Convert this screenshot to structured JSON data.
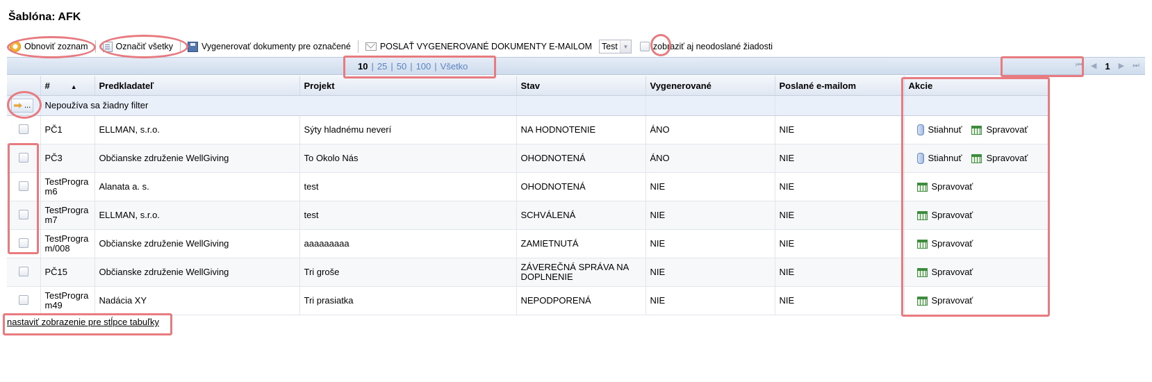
{
  "page_title": "Šablóna: AFK",
  "toolbar": {
    "refresh_label": "Obnoviť zoznam",
    "select_all_label": "Označiť všetky",
    "generate_label": "Vygenerovať dokumenty pre označené",
    "send_label": "POSLAŤ VYGENEROVANÉ DOKUMENTY E-MAILOM",
    "select_value": "Test",
    "show_unsent_label": "zobraziť aj neodoslané žiadosti"
  },
  "pager": {
    "page_sizes": [
      "10",
      "25",
      "50",
      "100",
      "Všetko"
    ],
    "current_size": "10",
    "current_page": "1",
    "first": "⏮",
    "prev": "◀",
    "next": "▶",
    "last": "⏭"
  },
  "table": {
    "headers": {
      "num": "#",
      "applicant": "Predkladateľ",
      "project": "Projekt",
      "status": "Stav",
      "generated": "Vygenerované",
      "emailed": "Poslané e-mailom",
      "actions": "Akcie"
    },
    "sort_indicator": "▲",
    "filter_button_label": "...",
    "filter_text": "Nepoužíva sa žiadny filter",
    "download_label": "Stiahnuť",
    "manage_label": "Spravovať",
    "rows": [
      {
        "num": "PČ1",
        "applicant": "ELLMAN, s.r.o.",
        "project": "Sýty hladnému neverí",
        "status": "NA HODNOTENIE",
        "generated": "ÁNO",
        "emailed": "NIE",
        "download": true
      },
      {
        "num": "PČ3",
        "applicant": "Občianske združenie WellGiving",
        "project": "To Okolo Nás",
        "status": "OHODNOTENÁ",
        "generated": "ÁNO",
        "emailed": "NIE",
        "download": true
      },
      {
        "num": "TestProgram6",
        "applicant": "Alanata a. s.",
        "project": "test",
        "status": "OHODNOTENÁ",
        "generated": "NIE",
        "emailed": "NIE",
        "download": false
      },
      {
        "num": "TestProgram7",
        "applicant": "ELLMAN, s.r.o.",
        "project": "test",
        "status": "SCHVÁLENÁ",
        "generated": "NIE",
        "emailed": "NIE",
        "download": false
      },
      {
        "num": "TestProgram/008",
        "applicant": "Občianske združenie WellGiving",
        "project": "aaaaaaaaa",
        "status": "ZAMIETNUTÁ",
        "generated": "NIE",
        "emailed": "NIE",
        "download": false
      },
      {
        "num": "PČ15",
        "applicant": "Občianske združenie WellGiving",
        "project": "Tri groše",
        "status": "ZÁVEREČNÁ SPRÁVA NA DOPLNENIE",
        "generated": "NIE",
        "emailed": "NIE",
        "download": false
      },
      {
        "num": "TestProgram49",
        "applicant": "Nadácia XY",
        "project": "Tri prasiatka",
        "status": "NEPODPORENÁ",
        "generated": "NIE",
        "emailed": "NIE",
        "download": false
      }
    ]
  },
  "footer_link": "nastaviť zobrazenie pre stĺpce tabuľky",
  "colors": {
    "highlight": "#e77b80",
    "link": "#5b84c2",
    "header_bg": "#dfe7f2"
  }
}
